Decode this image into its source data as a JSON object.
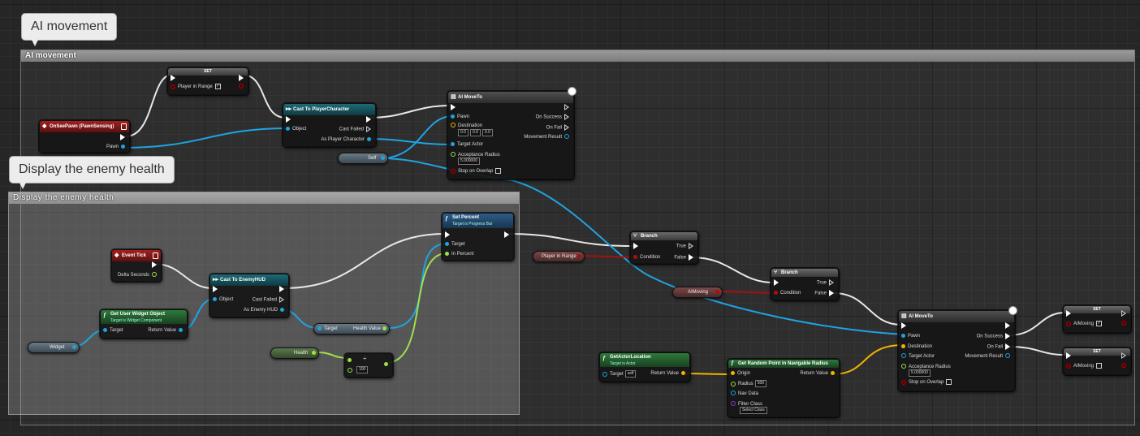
{
  "comments": {
    "ai_movement": {
      "bubble": "AI movement",
      "header": "AI movement"
    },
    "enemy_health": {
      "bubble": "Display the enemy health",
      "header": "Display the enemy health"
    }
  },
  "colors": {
    "object_pin": "#1fa3e0",
    "bool_pin": "#a81010",
    "vector_pin": "#f0b400",
    "float_pin": "#9fe04a"
  },
  "nodes": {
    "set_top": {
      "title": "SET",
      "pin": "Player in Range",
      "checked": true
    },
    "on_see_pawn": {
      "title": "OnSeePawn (PawnSensing)",
      "pawn": "Pawn"
    },
    "cast_player": {
      "title": "Cast To PlayerCharacter",
      "object": "Object",
      "failed": "Cast Failed",
      "as": "As Player Character"
    },
    "self_var": {
      "label": "Self"
    },
    "ai_move_to_1": {
      "title": "AI MoveTo",
      "pawn": "Pawn",
      "destination": "Destination",
      "dest_x": "0.0",
      "dest_y": "0.0",
      "dest_z": "0.0",
      "target_actor": "Target Actor",
      "acceptance": "Acceptance Radius",
      "acceptance_val": "5.000000",
      "stop_overlap": "Stop on Overlap",
      "on_success": "On Success",
      "on_fail": "On Fail",
      "movement_result": "Movement Result"
    },
    "branch_1": {
      "title": "Branch",
      "condition": "Condition",
      "true_label": "True",
      "false_label": "False"
    },
    "player_in_range_var": {
      "label": "Player in Range"
    },
    "branch_2": {
      "title": "Branch",
      "condition": "Condition",
      "true_label": "True",
      "false_label": "False"
    },
    "aimoving_var": {
      "label": "AIMoving"
    },
    "ai_move_to_2": {
      "title": "AI MoveTo",
      "pawn": "Pawn",
      "destination": "Destination",
      "target_actor": "Target Actor",
      "acceptance": "Acceptance Radius",
      "acceptance_val": "5.000000",
      "stop_overlap": "Stop on Overlap",
      "on_success": "On Success",
      "on_fail": "On Fail",
      "movement_result": "Movement Result"
    },
    "set_true": {
      "title": "SET",
      "pin": "AIMoving",
      "checked": true
    },
    "set_false": {
      "title": "SET",
      "pin": "AIMoving",
      "checked": false
    },
    "get_actor_location": {
      "title": "GetActorLocation",
      "subtitle": "Target is Actor",
      "target": "Target",
      "target_val": "self",
      "return_value": "Return Value"
    },
    "random_point": {
      "title": "Get Random Point in Navigable Radius",
      "origin": "Origin",
      "radius": "Radius",
      "radius_val": "500",
      "nav_data": "Nav Data",
      "filter_class": "Filter Class",
      "filter_val": "Select Class",
      "return_value": "Return Value"
    },
    "event_tick": {
      "title": "Event Tick",
      "delta": "Delta Seconds"
    },
    "get_user_widget": {
      "title": "Get User Widget Object",
      "subtitle": "Target is Widget Component",
      "target": "Target",
      "return_value": "Return Value"
    },
    "widget_var": {
      "label": "Widget"
    },
    "cast_enemy_hud": {
      "title": "Cast To EnemyHUD",
      "object": "Object",
      "failed": "Cast Failed",
      "as": "As Enemy HUD"
    },
    "health_value_get": {
      "target": "Target",
      "value": "Health Value"
    },
    "health_var": {
      "label": "Health"
    },
    "divide": {
      "symbol": "÷",
      "b_val": "100"
    },
    "set_percent": {
      "title": "Set Percent",
      "subtitle": "Target is Progress Bar",
      "target": "Target",
      "in_percent": "In Percent"
    }
  }
}
